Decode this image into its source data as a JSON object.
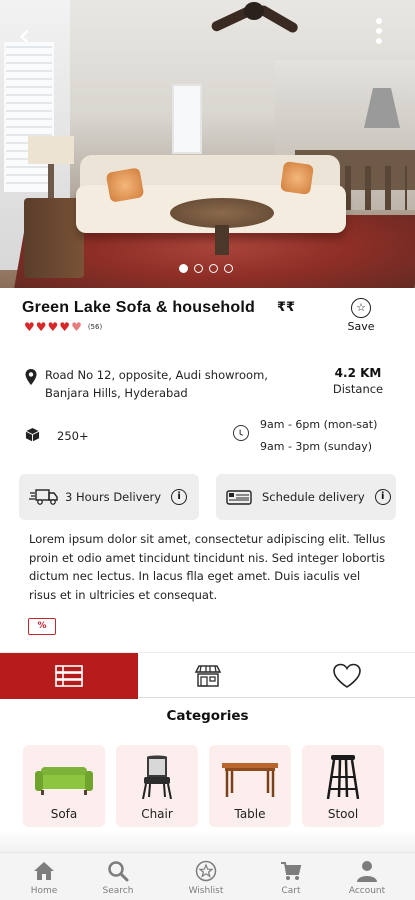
{
  "listing": {
    "title": "Green Lake Sofa & household",
    "price_level": "₹₹",
    "review_count": "(56)",
    "rating_stars": 4.5,
    "save_label": "Save",
    "address_line1": "Road No 12, opposite, Audi showroom,",
    "address_line2": "Banjara Hills, Hyderabad",
    "distance_value": "4.2 KM",
    "distance_label": "Distance",
    "stock_count": "250+",
    "hours_weekday": "9am - 6pm (mon-sat)",
    "hours_sunday": "9am - 3pm  (sunday)",
    "description": "Lorem ipsum dolor sit amet, consectetur adipiscing elit. Tellus proin et odio amet tincidunt tincidunt nis. Sed integer lobortis dictum nec lectus. In lacus  flla eget amet. Duis iaculis vel risus et in ultricies et consequat.",
    "coupon_text": "%"
  },
  "hero": {
    "slide_count": 4,
    "active_slide": 1
  },
  "delivery": {
    "fast_label": "3 Hours Delivery",
    "schedule_label": "Schedule delivery"
  },
  "categories": {
    "title": "Categories",
    "items": [
      {
        "label": "Sofa",
        "icon": "sofa-icon"
      },
      {
        "label": "Chair",
        "icon": "chair-icon"
      },
      {
        "label": "Table",
        "icon": "table-icon"
      },
      {
        "label": "Stool",
        "icon": "stool-icon"
      }
    ]
  },
  "nav": {
    "items": [
      {
        "label": "Home",
        "icon": "home-icon"
      },
      {
        "label": "Search",
        "icon": "search-icon"
      },
      {
        "label": "Wishlist",
        "icon": "star-icon"
      },
      {
        "label": "Cart",
        "icon": "cart-icon"
      },
      {
        "label": "Account",
        "icon": "account-icon"
      }
    ]
  },
  "colors": {
    "accent": "#b71c1c",
    "star": "#d62828",
    "category_bg": "#fdeeee"
  }
}
